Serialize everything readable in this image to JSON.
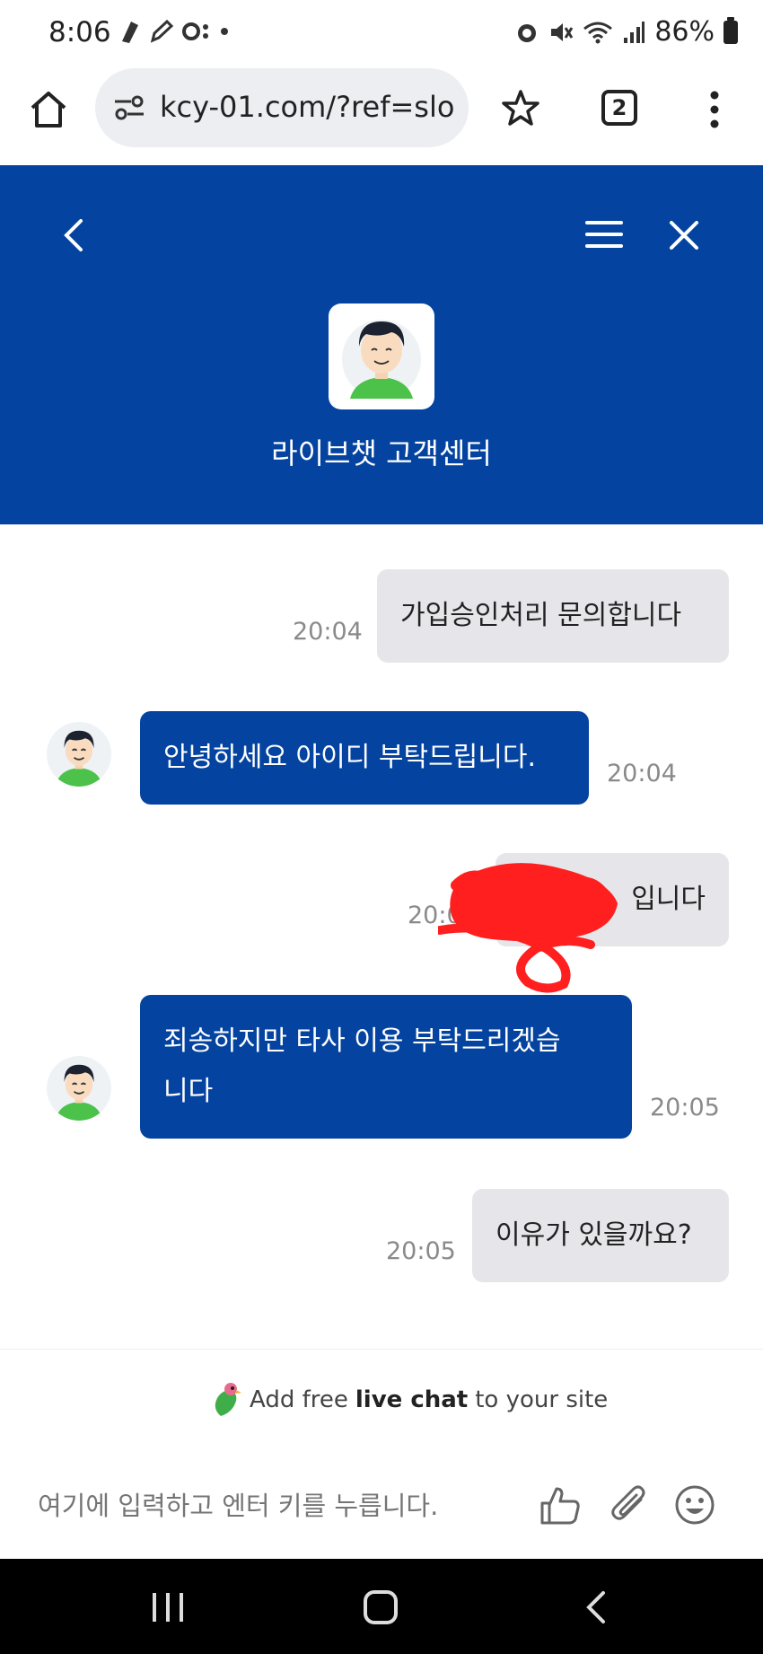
{
  "status_bar": {
    "time": "8:06",
    "battery": "86%"
  },
  "browser": {
    "url": "kcy-01.com/?ref=slo",
    "tab_count": "2"
  },
  "chat_header": {
    "title": "라이브챗 고객센터"
  },
  "messages": [
    {
      "from": "user",
      "text": "가입승인처리 문의합니다",
      "time": "20:04"
    },
    {
      "from": "agent",
      "text": "안녕하세요 아이디 부탁드립니다.",
      "time": "20:04"
    },
    {
      "from": "user",
      "text": "입니다",
      "time": "20:05",
      "redacted": true
    },
    {
      "from": "agent",
      "line1": "죄송하지만 타사 이용 부탁드리겠습",
      "line2": "니다",
      "time": "20:05"
    },
    {
      "from": "user",
      "text": "이유가 있을까요?",
      "time": "20:05"
    }
  ],
  "footer": {
    "powered_pre": "Add free",
    "powered_bold": "live chat",
    "powered_post": "to your site",
    "input_placeholder": "여기에 입력하고 엔터 키를 누릅니다."
  },
  "colors": {
    "brand": "#0444a0",
    "user_bubble": "#e6e6ea",
    "redaction": "#ff1f1f"
  },
  "icons": [
    "home-icon",
    "site-settings-icon",
    "star-icon",
    "tabs-icon",
    "more-icon",
    "back-icon",
    "hamburger-icon",
    "close-icon",
    "thumbs-up-icon",
    "paperclip-icon",
    "emoji-icon"
  ]
}
